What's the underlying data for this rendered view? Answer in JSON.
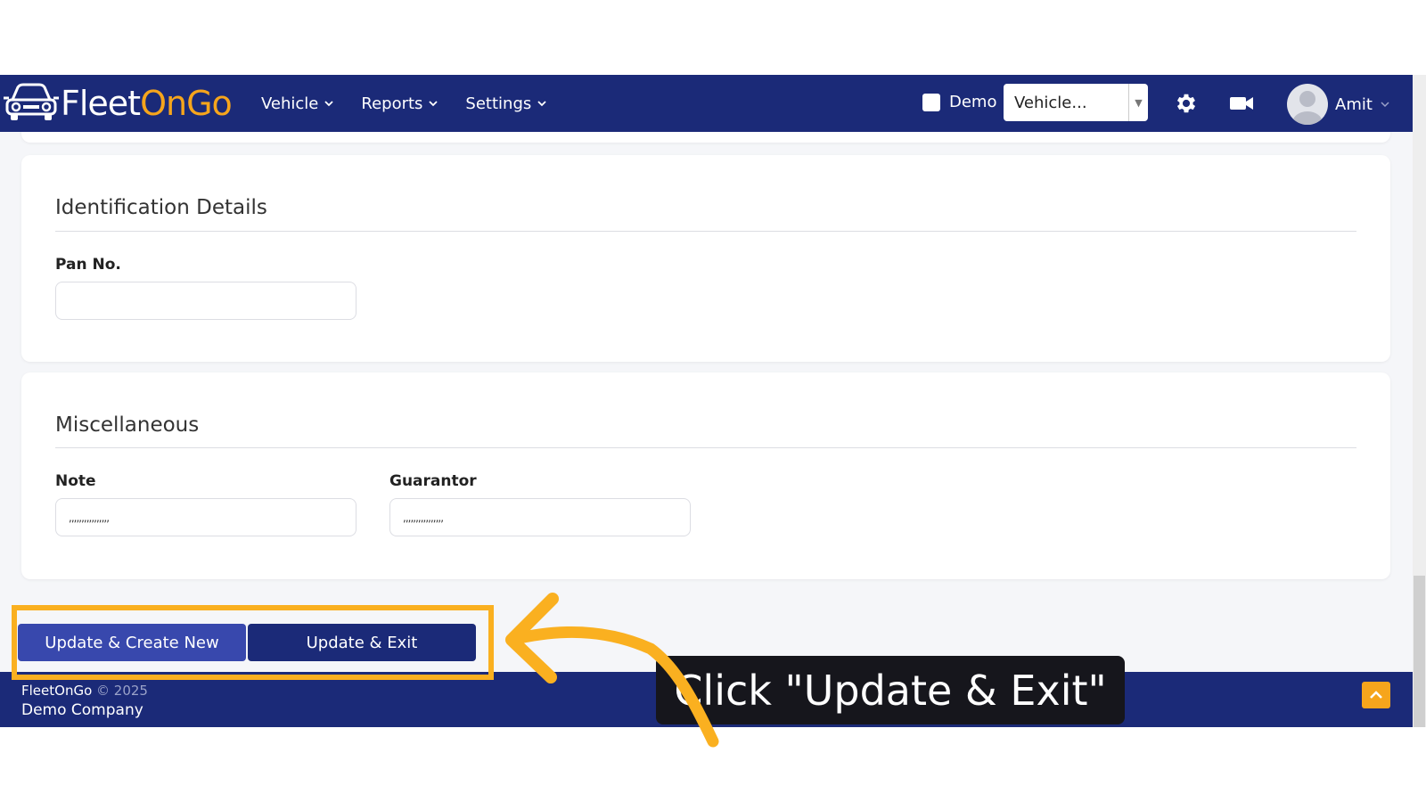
{
  "navbar": {
    "logo_fleet": "Fleet",
    "logo_ongo": "OnGo",
    "menu": [
      {
        "label": "Vehicle"
      },
      {
        "label": "Reports"
      },
      {
        "label": "Settings"
      }
    ],
    "demo_label": "Demo",
    "vehicle_select": "Vehicle...",
    "user_name": "Amit",
    "icons": [
      "car-logo-icon",
      "chevron-down-icon",
      "gear-icon",
      "video-camera-icon",
      "user-avatar-icon"
    ]
  },
  "identification": {
    "title": "Identification Details",
    "pan_label": "Pan No.",
    "pan_value": ""
  },
  "misc": {
    "title": "Miscellaneous",
    "note_label": "Note",
    "note_value": ",,,,,,,,,,,,,,,,",
    "guarantor_label": "Guarantor",
    "guarantor_value": ",,,,,,,,,,,,,,,,"
  },
  "actions": {
    "create_new": "Update & Create New",
    "exit": "Update & Exit"
  },
  "footer": {
    "brand": "FleetOnGo",
    "copyright": "© 2025",
    "company": "Demo Company"
  },
  "tutorial": {
    "callout": "Click \"Update & Exit\"",
    "accent_color": "#fab020"
  },
  "colors": {
    "navbar": "#1b2a78",
    "brand_orange": "#f6a51c",
    "primary_button": "#3848ad"
  }
}
